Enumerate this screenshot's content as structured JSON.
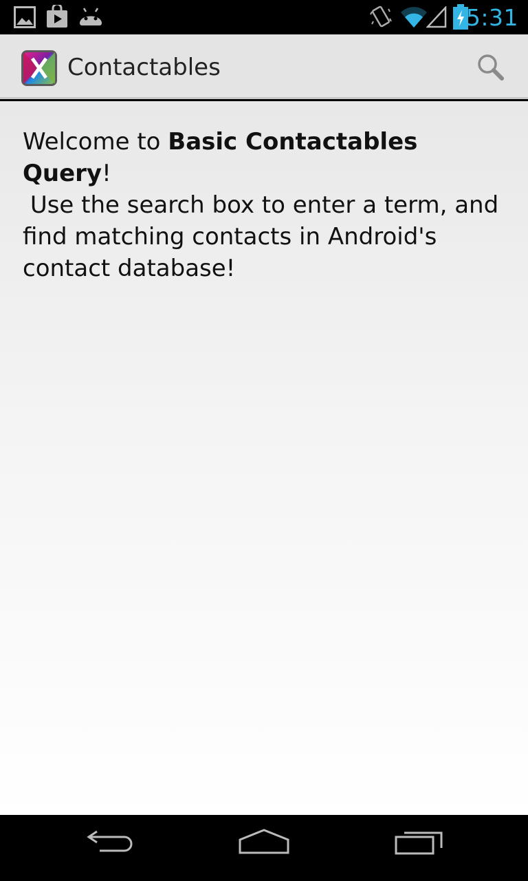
{
  "status_bar": {
    "time": "5:31",
    "time_color": "#33b5e5",
    "left_icons": [
      "gallery-notification-icon",
      "play-store-notification-icon",
      "android-notification-icon"
    ],
    "right_icons": [
      "vibrate-icon",
      "wifi-icon",
      "signal-icon",
      "battery-charging-icon"
    ]
  },
  "action_bar": {
    "title": "Contactables",
    "app_icon": "app-logo-icon",
    "search_icon": "search-icon"
  },
  "content": {
    "welcome_prefix": "Welcome to ",
    "welcome_bold": "Basic Contactables Query",
    "welcome_suffix": "!",
    "instructions": " Use the search box to enter a term, and find matching contacts in Android's contact database!"
  },
  "nav_bar": {
    "buttons": [
      "back-icon",
      "home-icon",
      "recent-apps-icon"
    ]
  }
}
